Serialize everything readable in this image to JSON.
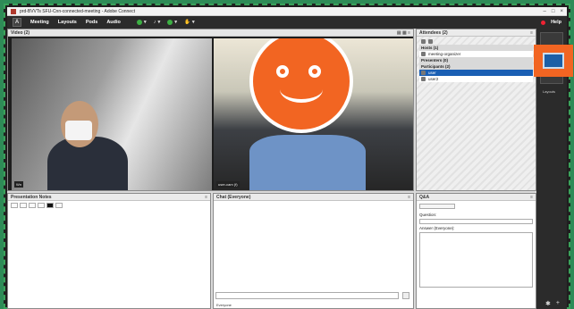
{
  "window": {
    "title": "prd-BVVTs SFU-Cnn-connected-meeting - Adobe Connect"
  },
  "menubar": {
    "items": [
      "Meeting",
      "Layouts",
      "Pods",
      "Audio"
    ],
    "right_label": "Help"
  },
  "video_pod": {
    "title": "Video",
    "count": "(2)",
    "cam1_label": "Wn",
    "cam2_label": "user-cam (f)"
  },
  "attendees": {
    "title": "Attendees",
    "count": "(2)",
    "hosts_label": "Hosts (1)",
    "host_name": "meeting-organizer",
    "presenters_label": "Presenters (0)",
    "participants_label": "Participants (2)",
    "participant1": "user",
    "participant2": "user2"
  },
  "notes_pod": {
    "title": "Presentation Notes"
  },
  "chat_pod": {
    "title": "Chat",
    "tab": "(Everyone)",
    "to_label": "Everyone"
  },
  "qa_pod": {
    "title": "Q&A",
    "question_label": "Question:",
    "answer_label": "Answer (Everyone):"
  },
  "right_rail": {
    "layout_label": "Layouts"
  }
}
